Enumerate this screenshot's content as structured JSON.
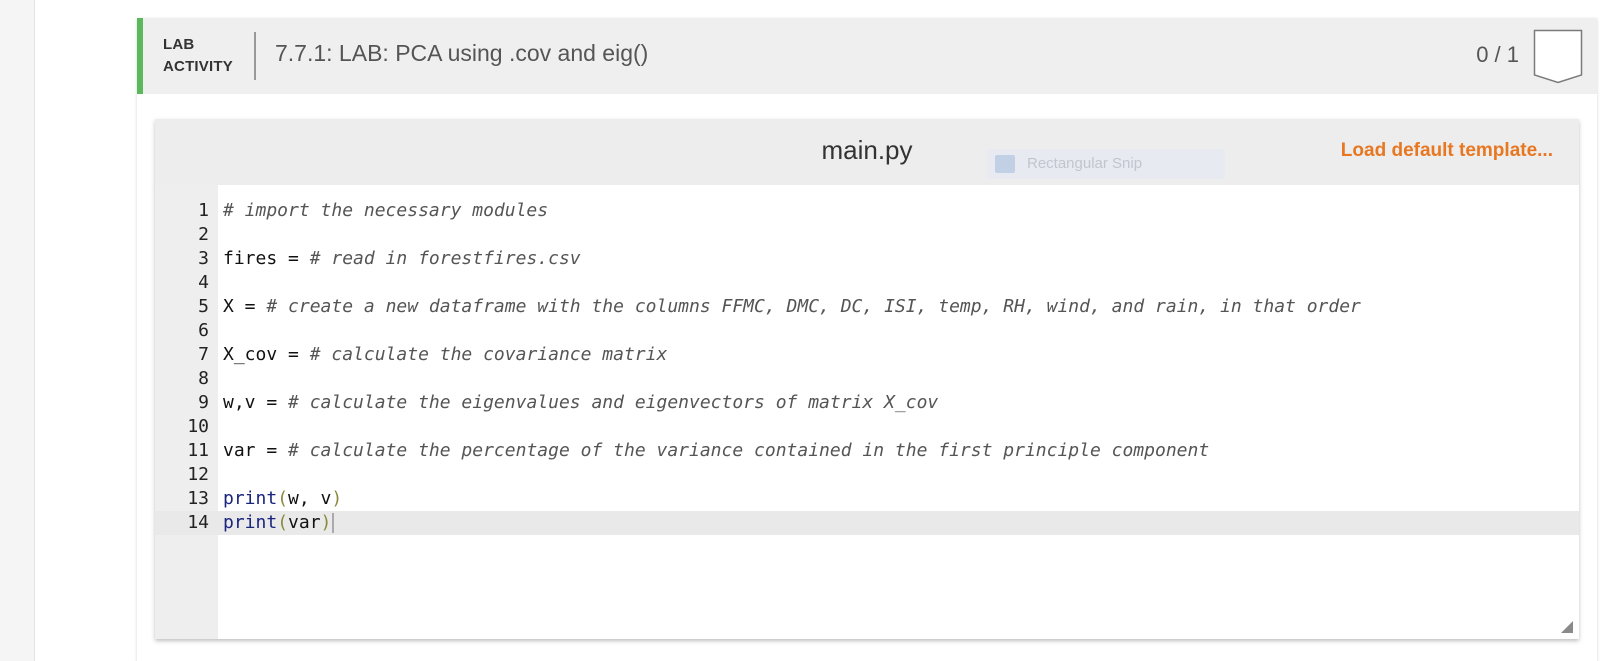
{
  "activity": {
    "type_line1": "LAB",
    "type_line2": "ACTIVITY",
    "title": "7.7.1: LAB: PCA using .cov and eig()",
    "score": "0 / 1",
    "accent_color": "#5cb85c"
  },
  "editor": {
    "filename": "main.py",
    "load_template_label": "Load default template...",
    "overlay_label": "Rectangular Snip",
    "active_line": 14,
    "lines": [
      {
        "n": "1",
        "segs": [
          {
            "t": "# import the necessary modules",
            "c": "comment"
          }
        ]
      },
      {
        "n": "2",
        "segs": []
      },
      {
        "n": "3",
        "segs": [
          {
            "t": "fires = ",
            "c": "plain"
          },
          {
            "t": "# read in forestfires.csv",
            "c": "comment"
          }
        ]
      },
      {
        "n": "4",
        "segs": []
      },
      {
        "n": "5",
        "segs": [
          {
            "t": "X = ",
            "c": "plain"
          },
          {
            "t": "# create a new dataframe with the columns FFMC, DMC, DC, ISI, temp, RH, wind, and rain, in that order",
            "c": "comment"
          }
        ]
      },
      {
        "n": "6",
        "segs": []
      },
      {
        "n": "7",
        "segs": [
          {
            "t": "X_cov = ",
            "c": "plain"
          },
          {
            "t": "# calculate the covariance matrix",
            "c": "comment"
          }
        ]
      },
      {
        "n": "8",
        "segs": []
      },
      {
        "n": "9",
        "segs": [
          {
            "t": "w,v = ",
            "c": "plain"
          },
          {
            "t": "# calculate the eigenvalues and eigenvectors of matrix X_cov",
            "c": "comment"
          }
        ]
      },
      {
        "n": "10",
        "segs": []
      },
      {
        "n": "11",
        "segs": [
          {
            "t": "var = ",
            "c": "plain"
          },
          {
            "t": "# calculate the percentage of the variance contained in the first principle component",
            "c": "comment"
          }
        ]
      },
      {
        "n": "12",
        "segs": []
      },
      {
        "n": "13",
        "segs": [
          {
            "t": "print",
            "c": "builtin"
          },
          {
            "t": "(",
            "c": "paren"
          },
          {
            "t": "w, v",
            "c": "plain"
          },
          {
            "t": ")",
            "c": "paren"
          }
        ]
      },
      {
        "n": "14",
        "segs": [
          {
            "t": "print",
            "c": "builtin"
          },
          {
            "t": "(",
            "c": "paren"
          },
          {
            "t": "var",
            "c": "plain"
          },
          {
            "t": ")",
            "c": "paren"
          }
        ]
      }
    ]
  },
  "icons": {
    "score_badge": "bookmark-badge-icon",
    "resize": "resize-grip-icon",
    "snip": "scissors-icon"
  }
}
